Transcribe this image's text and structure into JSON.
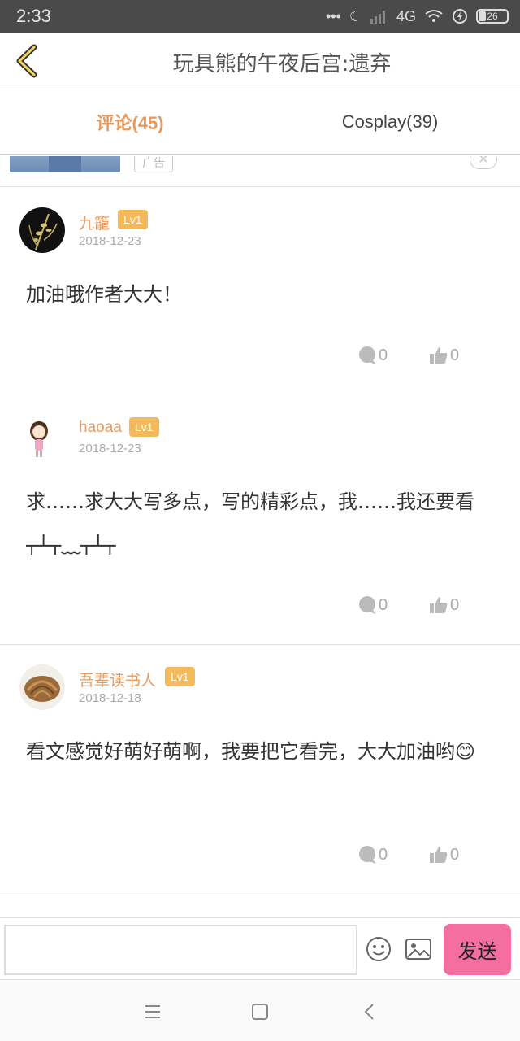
{
  "status_bar": {
    "time": "2:33",
    "network": "4G",
    "battery": "26"
  },
  "header": {
    "title": "玩具熊的午夜后宫:遗弃"
  },
  "tabs": [
    {
      "label": "评论(45)",
      "active": true
    },
    {
      "label": "Cosplay(39)",
      "active": false
    }
  ],
  "ad": {
    "tag": "广告",
    "close": "✕"
  },
  "comments": [
    {
      "username": "九籠",
      "level": "Lv1",
      "date": "2018-12-23",
      "text": "加油哦作者大大！",
      "replies": "0",
      "likes": "0"
    },
    {
      "username": "haoaa",
      "level": "Lv1",
      "date": "2018-12-23",
      "text": "求……求大大写多点，写的精彩点，我……我还要看┬┴┬﹏┬┴┬",
      "replies": "0",
      "likes": "0"
    },
    {
      "username": "吾辈读书人",
      "level": "Lv1",
      "date": "2018-12-18",
      "text": "看文感觉好萌好萌啊，我要把它看完，大大加油哟😊",
      "replies": "0",
      "likes": "0"
    }
  ],
  "input": {
    "placeholder": "",
    "send_label": "发送"
  },
  "colors": {
    "accent": "#e89a5c",
    "badge": "#f3b95a",
    "send": "#f56ea0"
  }
}
